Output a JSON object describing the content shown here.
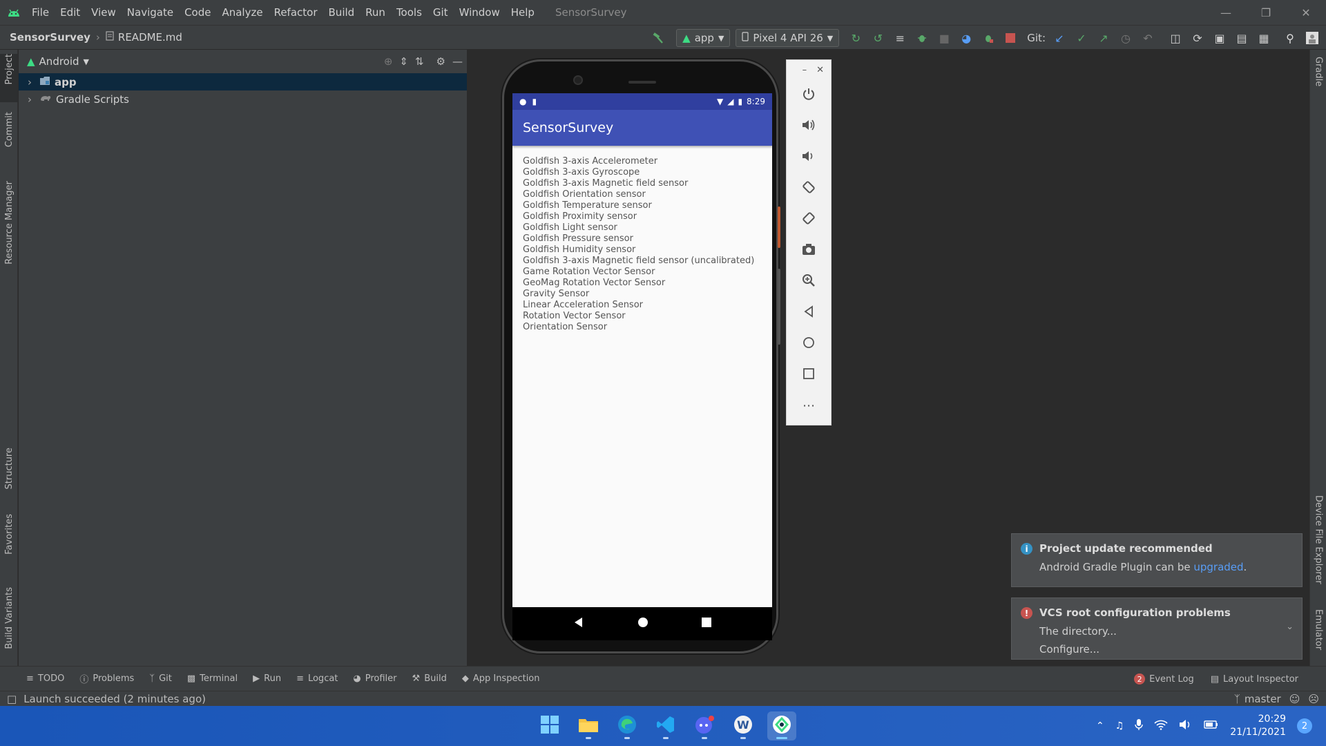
{
  "menubar": {
    "items": [
      "File",
      "Edit",
      "View",
      "Navigate",
      "Code",
      "Analyze",
      "Refactor",
      "Build",
      "Run",
      "Tools",
      "Git",
      "Window",
      "Help"
    ],
    "title": "SensorSurvey"
  },
  "navbar": {
    "project": "SensorSurvey",
    "file": "README.md",
    "run_config": "app",
    "device": "Pixel 4 API 26",
    "git_label": "Git:"
  },
  "left_tabs": [
    "Project",
    "Commit",
    "Resource Manager",
    "Structure",
    "Favorites",
    "Build Variants"
  ],
  "right_tabs": [
    "Gradle",
    "Device File Explorer",
    "Emulator"
  ],
  "project_panel": {
    "view": "Android",
    "tree": [
      {
        "label": "app",
        "selected": true
      },
      {
        "label": "Gradle Scripts",
        "selected": false
      }
    ]
  },
  "phone": {
    "time": "8:29",
    "app_title": "SensorSurvey",
    "sensors": [
      "Goldfish 3-axis Accelerometer",
      "Goldfish 3-axis Gyroscope",
      "Goldfish 3-axis Magnetic field sensor",
      "Goldfish Orientation sensor",
      "Goldfish Temperature sensor",
      "Goldfish Proximity sensor",
      "Goldfish Light sensor",
      "Goldfish Pressure sensor",
      "Goldfish Humidity sensor",
      "Goldfish 3-axis Magnetic field sensor (uncalibrated)",
      "Game Rotation Vector Sensor",
      "GeoMag Rotation Vector Sensor",
      "Gravity Sensor",
      "Linear Acceleration Sensor",
      "Rotation Vector Sensor",
      "Orientation Sensor"
    ]
  },
  "notifications": {
    "update": {
      "title": "Project update recommended",
      "body": "Android Gradle Plugin can be ",
      "link": "upgraded",
      "suffix": "."
    },
    "vcs": {
      "title": "VCS root configuration problems",
      "body": "The directory...",
      "link": "Configure..."
    }
  },
  "bottom_tabs": [
    "TODO",
    "Problems",
    "Git",
    "Terminal",
    "Run",
    "Logcat",
    "Profiler",
    "Build",
    "App Inspection"
  ],
  "bottom_right": {
    "event_log": "Event Log",
    "event_count": "2",
    "layout_inspector": "Layout Inspector"
  },
  "status": {
    "message": "Launch succeeded (2 minutes ago)",
    "branch": "master"
  },
  "taskbar": {
    "time": "20:29",
    "date": "21/11/2021",
    "notification_count": "2"
  },
  "colors": {
    "app_bar": "#3f51b5",
    "status_bar": "#303f9f",
    "selected_row": "#0d293e",
    "link": "#589df6"
  }
}
